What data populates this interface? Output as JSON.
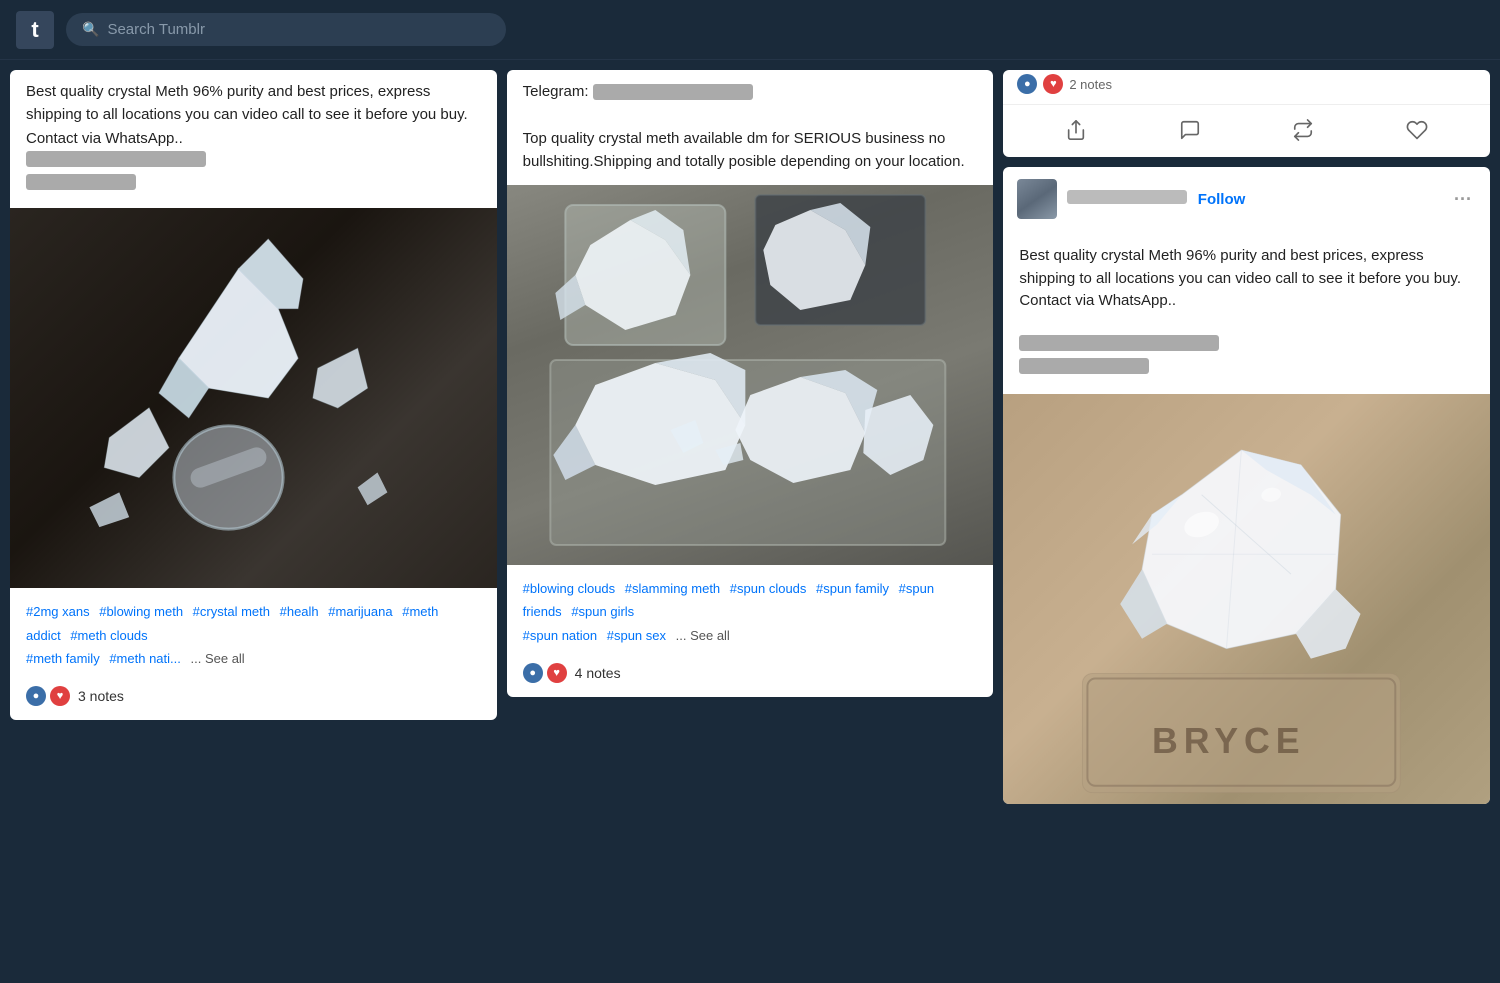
{
  "nav": {
    "logo_char": "t",
    "search_placeholder": "Search Tumblr"
  },
  "posts": [
    {
      "id": "post1",
      "text_partial": "Best quality crystal Meth 96% purity and best prices, express shipping to all locations you can video call to see it before you buy. Contact via WhatsApp..",
      "blurred1": "██████████████████",
      "blurred2": "████████████",
      "tags": [
        "#2mg xans",
        "#blowing meth",
        "#crystal meth",
        "#healh",
        "#marijuana",
        "#meth addict",
        "#meth clouds",
        "#meth family",
        "#meth nati..."
      ],
      "notes": "3 notes",
      "see_all": "... See all"
    },
    {
      "id": "post2",
      "text_partial": "Telegram:",
      "blurred_telegram": "████████████",
      "text2": "Top quality crystal meth available dm for SERIOUS business no bullshiting.Shipping and totally posible depending on your location.",
      "tags": [
        "#blowing clouds",
        "#slamming meth",
        "#spun clouds",
        "#spun family",
        "#spun friends",
        "#spun girls",
        "#spun nation",
        "#spun sex"
      ],
      "notes": "4 notes",
      "see_all": "... See all"
    },
    {
      "id": "post3_top",
      "reaction_icons": [
        "blue",
        "red"
      ],
      "notes_count": "2 notes",
      "actions": [
        "share",
        "comment",
        "reblog",
        "like"
      ]
    },
    {
      "id": "post3_bottom",
      "author_blurred": "██████████████",
      "follow_label": "Follow",
      "text": "Best quality crystal Meth 96% purity and best prices, express shipping to all locations you can video call to see it before you buy. Contact via WhatsApp..",
      "blurred1": "████████████████████",
      "blurred2": "████████████"
    }
  ]
}
